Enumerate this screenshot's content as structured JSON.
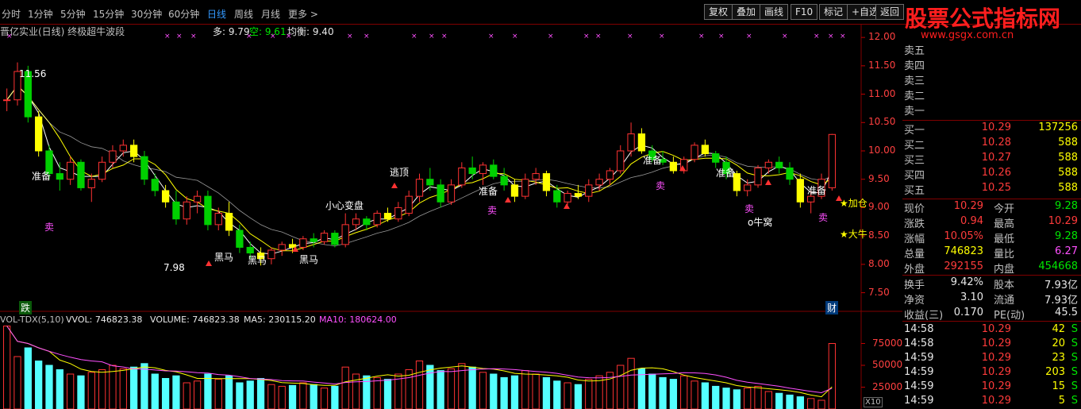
{
  "topbar": {
    "periods": [
      "分时",
      "1分钟",
      "5分钟",
      "15分钟",
      "30分钟",
      "60分钟",
      "日线",
      "周线",
      "月线",
      "更多 >"
    ],
    "active_period": "日线",
    "buttons": [
      "复权",
      "叠加",
      "画线",
      "F10",
      "标记",
      "+自选",
      "返回"
    ]
  },
  "logo": {
    "title": "股票公式指标网",
    "url": "www.gsgx.com.cn"
  },
  "chart_header": {
    "stock_title": "晋亿实业(日线) 终极超牛波段",
    "duo": "多: 9.79",
    "kong": "空: 9.61",
    "junheng": "均衡: 9.40"
  },
  "volume_header": {
    "name": "VOL-TDX(5,10)",
    "vvol": "VVOL: 746823.38",
    "volume": "VOLUME: 746823.38",
    "ma5": "MA5: 230115.20",
    "ma10": "MA10: 180624.00"
  },
  "annotations": {
    "high": "11.56",
    "low": "7.98",
    "xiaoxin": "小心变盘",
    "taoding": "逃顶",
    "heima": "黑马",
    "zhunbei": "准备",
    "mai": "卖",
    "niuwo": "o牛窝",
    "jiacang": "加仓",
    "daniu": "大牛",
    "die": "跌",
    "cai": "财",
    "x10": "X10"
  },
  "colors": {
    "up": "#ff3232",
    "down": "#54ffff",
    "green": "#00d000",
    "yellow": "#ffff00",
    "ma1": "#ffffff",
    "ma2": "#ffff00",
    "grid": "#800000"
  },
  "chart_data": {
    "type": "candlestick",
    "price_axis": {
      "ticks": [
        "12.00",
        "11.50",
        "11.00",
        "10.50",
        "10.00",
        "9.50",
        "9.00",
        "8.50",
        "8.00",
        "7.50"
      ],
      "range": [
        7.2,
        12.1
      ]
    },
    "volume_axis": {
      "ticks": [
        "75000",
        "50000",
        "25000"
      ],
      "range": [
        0,
        100000
      ]
    },
    "candles": [
      [
        10.9,
        11.1,
        10.7,
        10.9
      ],
      [
        10.9,
        11.56,
        10.8,
        11.4
      ],
      [
        11.4,
        11.5,
        10.5,
        10.6
      ],
      [
        10.6,
        10.7,
        9.9,
        10.0
      ],
      [
        10.0,
        10.1,
        9.5,
        9.6
      ],
      [
        9.6,
        9.8,
        9.3,
        9.5
      ],
      [
        9.5,
        9.9,
        9.4,
        9.8
      ],
      [
        9.8,
        9.85,
        9.3,
        9.35
      ],
      [
        9.35,
        9.6,
        9.1,
        9.5
      ],
      [
        9.5,
        9.9,
        9.45,
        9.8
      ],
      [
        9.8,
        10.1,
        9.7,
        10.0
      ],
      [
        10.0,
        10.2,
        9.9,
        10.1
      ],
      [
        10.1,
        10.2,
        9.8,
        9.9
      ],
      [
        9.9,
        10.0,
        9.4,
        9.5
      ],
      [
        9.5,
        9.6,
        9.2,
        9.3
      ],
      [
        9.3,
        9.4,
        9.0,
        9.1
      ],
      [
        9.1,
        9.3,
        8.7,
        8.8
      ],
      [
        8.8,
        9.2,
        8.7,
        9.1
      ],
      [
        9.1,
        9.3,
        8.9,
        9.2
      ],
      [
        9.2,
        9.3,
        8.6,
        8.7
      ],
      [
        8.7,
        9.0,
        8.6,
        8.9
      ],
      [
        8.9,
        9.1,
        8.5,
        8.6
      ],
      [
        8.6,
        8.7,
        8.2,
        8.3
      ],
      [
        8.3,
        8.4,
        8.1,
        8.2
      ],
      [
        8.2,
        8.3,
        7.98,
        8.1
      ],
      [
        8.1,
        8.3,
        8.0,
        8.25
      ],
      [
        8.25,
        8.4,
        8.15,
        8.35
      ],
      [
        8.35,
        8.45,
        8.2,
        8.3
      ],
      [
        8.3,
        8.5,
        8.25,
        8.45
      ],
      [
        8.45,
        8.55,
        8.3,
        8.4
      ],
      [
        8.4,
        8.6,
        8.35,
        8.55
      ],
      [
        8.55,
        8.6,
        8.3,
        8.35
      ],
      [
        8.35,
        8.9,
        8.3,
        8.7
      ],
      [
        8.7,
        8.9,
        8.6,
        8.8
      ],
      [
        8.8,
        8.85,
        8.6,
        8.7
      ],
      [
        8.7,
        8.95,
        8.65,
        8.9
      ],
      [
        8.9,
        9.0,
        8.75,
        8.8
      ],
      [
        8.8,
        9.1,
        8.75,
        9.0
      ],
      [
        8.9,
        9.3,
        8.85,
        9.2
      ],
      [
        9.2,
        9.6,
        9.1,
        9.5
      ],
      [
        9.5,
        9.7,
        9.3,
        9.4
      ],
      [
        9.4,
        9.5,
        9.0,
        9.1
      ],
      [
        9.1,
        9.5,
        9.05,
        9.4
      ],
      [
        9.4,
        9.8,
        9.35,
        9.7
      ],
      [
        9.7,
        9.9,
        9.5,
        9.6
      ],
      [
        9.6,
        9.8,
        9.4,
        9.75
      ],
      [
        9.75,
        9.85,
        9.5,
        9.55
      ],
      [
        9.55,
        9.7,
        9.3,
        9.4
      ],
      [
        9.4,
        9.5,
        9.1,
        9.2
      ],
      [
        9.2,
        9.6,
        9.15,
        9.5
      ],
      [
        9.5,
        9.7,
        9.4,
        9.6
      ],
      [
        9.6,
        9.65,
        9.2,
        9.3
      ],
      [
        9.3,
        9.4,
        9.0,
        9.1
      ],
      [
        9.1,
        9.3,
        9.05,
        9.25
      ],
      [
        9.25,
        9.4,
        9.15,
        9.2
      ],
      [
        9.2,
        9.5,
        9.1,
        9.4
      ],
      [
        9.4,
        9.6,
        9.3,
        9.5
      ],
      [
        9.5,
        9.7,
        9.4,
        9.65
      ],
      [
        9.65,
        10.1,
        9.6,
        10.0
      ],
      [
        10.0,
        10.5,
        9.9,
        10.3
      ],
      [
        10.3,
        10.4,
        9.95,
        10.0
      ],
      [
        10.0,
        10.1,
        9.8,
        9.85
      ],
      [
        9.85,
        10.0,
        9.75,
        9.8
      ],
      [
        9.8,
        9.9,
        9.6,
        9.65
      ],
      [
        9.65,
        9.9,
        9.6,
        9.85
      ],
      [
        9.85,
        10.15,
        9.8,
        10.1
      ],
      [
        10.1,
        10.2,
        9.9,
        9.95
      ],
      [
        9.95,
        10.0,
        9.7,
        9.8
      ],
      [
        9.8,
        9.9,
        9.5,
        9.6
      ],
      [
        9.6,
        9.65,
        9.2,
        9.3
      ],
      [
        9.3,
        9.5,
        9.2,
        9.4
      ],
      [
        9.4,
        9.75,
        9.35,
        9.7
      ],
      [
        9.7,
        9.85,
        9.6,
        9.8
      ],
      [
        9.8,
        9.9,
        9.6,
        9.7
      ],
      [
        9.7,
        9.8,
        9.4,
        9.5
      ],
      [
        9.5,
        9.6,
        9.0,
        9.1
      ],
      [
        9.1,
        9.3,
        8.9,
        9.2
      ],
      [
        9.2,
        9.6,
        9.15,
        9.5
      ],
      [
        9.35,
        10.3,
        9.3,
        10.29
      ]
    ],
    "volumes": [
      95000,
      60000,
      70000,
      55000,
      50000,
      45000,
      40000,
      38000,
      42000,
      45000,
      50000,
      46000,
      48000,
      52000,
      40000,
      35000,
      38000,
      30000,
      32000,
      40000,
      34000,
      38000,
      30000,
      32000,
      35000,
      28000,
      26000,
      27000,
      30000,
      28000,
      24000,
      26000,
      48000,
      40000,
      38000,
      36000,
      34000,
      40000,
      45000,
      55000,
      50000,
      44000,
      46000,
      52000,
      48000,
      42000,
      40000,
      36000,
      38000,
      44000,
      40000,
      36000,
      32000,
      30000,
      28000,
      34000,
      38000,
      42000,
      50000,
      58000,
      46000,
      40000,
      36000,
      34000,
      38000,
      32000,
      30000,
      26000,
      24000,
      22000,
      24000,
      26000,
      20000,
      18000,
      16000,
      14000,
      12000,
      10000,
      75000
    ]
  },
  "panel": {
    "sell": [
      {
        "label": "卖五",
        "price": "",
        "vol": ""
      },
      {
        "label": "卖四",
        "price": "",
        "vol": ""
      },
      {
        "label": "卖三",
        "price": "",
        "vol": ""
      },
      {
        "label": "卖二",
        "price": "",
        "vol": ""
      },
      {
        "label": "卖一",
        "price": "",
        "vol": ""
      }
    ],
    "buy": [
      {
        "label": "买一",
        "price": "10.29",
        "vol": "137256"
      },
      {
        "label": "买二",
        "price": "10.28",
        "vol": "588"
      },
      {
        "label": "买三",
        "price": "10.27",
        "vol": "588"
      },
      {
        "label": "买四",
        "price": "10.26",
        "vol": "588"
      },
      {
        "label": "买五",
        "price": "10.25",
        "vol": "588"
      }
    ],
    "quote": [
      {
        "l1": "现价",
        "v1": "10.29",
        "c1": "red",
        "l2": "今开",
        "v2": "9.28",
        "c2": "grn"
      },
      {
        "l1": "涨跌",
        "v1": "0.94",
        "c1": "red",
        "l2": "最高",
        "v2": "10.29",
        "c2": "red"
      },
      {
        "l1": "涨幅",
        "v1": "10.05%",
        "c1": "red",
        "l2": "最低",
        "v2": "9.28",
        "c2": "grn"
      },
      {
        "l1": "总量",
        "v1": "746823",
        "c1": "yel",
        "l2": "量比",
        "v2": "6.27",
        "c2": "mag"
      },
      {
        "l1": "外盘",
        "v1": "292155",
        "c1": "red",
        "l2": "内盘",
        "v2": "454668",
        "c2": "grn"
      }
    ],
    "stats": [
      {
        "l1": "换手",
        "v1": "9.42%",
        "l2": "股本",
        "v2": "7.93亿"
      },
      {
        "l1": "净资",
        "v1": "3.10",
        "l2": "流通",
        "v2": "7.93亿"
      },
      {
        "l1": "收益(三)",
        "v1": "0.170",
        "l2": "PE(动)",
        "v2": "45.5"
      }
    ],
    "ticks": [
      {
        "time": "14:58",
        "price": "10.29",
        "vol": "42",
        "side": "S"
      },
      {
        "time": "14:58",
        "price": "10.29",
        "vol": "20",
        "side": "S"
      },
      {
        "time": "14:59",
        "price": "10.29",
        "vol": "23",
        "side": "S"
      },
      {
        "time": "14:59",
        "price": "10.29",
        "vol": "203",
        "side": "S"
      },
      {
        "time": "14:59",
        "price": "10.29",
        "vol": "15",
        "side": "S"
      },
      {
        "time": "14:59",
        "price": "10.29",
        "vol": "5",
        "side": "S"
      }
    ]
  }
}
